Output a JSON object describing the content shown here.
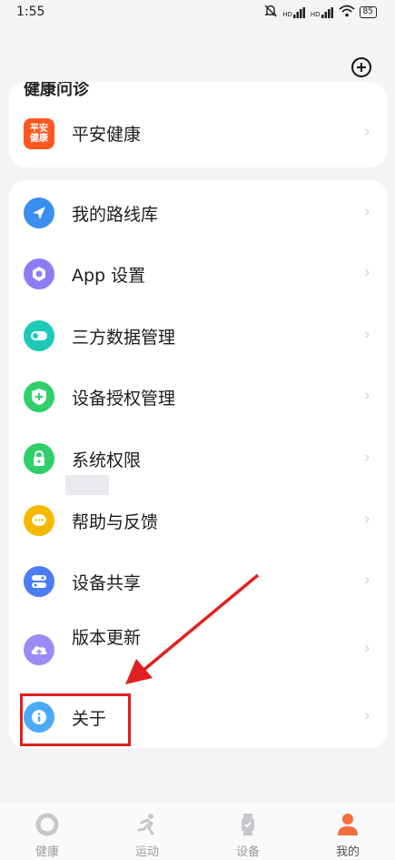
{
  "status": {
    "time": "1:55",
    "signal1": "HD",
    "signal2": "HD",
    "battery": "85"
  },
  "health_section": {
    "partial_title": "健康问诊",
    "items": [
      {
        "label": "平安健康",
        "icon": "ping-an-logo",
        "logo_text": "平安健康"
      }
    ]
  },
  "settings": {
    "items": [
      {
        "label": "我的路线库",
        "icon": "route-icon",
        "color": "#3a8ef0"
      },
      {
        "label": "App 设置",
        "icon": "settings-icon",
        "color": "#8b7cf5"
      },
      {
        "label": "三方数据管理",
        "icon": "toggle-icon",
        "color": "#1ec9b6"
      },
      {
        "label": "设备授权管理",
        "icon": "shield-icon",
        "color": "#2fcf6b"
      },
      {
        "label": "系统权限",
        "icon": "lock-icon",
        "color": "#2fcf6b"
      },
      {
        "label": "帮助与反馈",
        "icon": "chat-icon",
        "color": "#f5b800"
      },
      {
        "label": "设备共享",
        "icon": "share-toggle-icon",
        "color": "#4b7cf2"
      },
      {
        "label": "版本更新",
        "icon": "cloud-upload-icon",
        "color": "#9b8cf5"
      },
      {
        "label": "关于",
        "icon": "info-icon",
        "color": "#4aaaf5"
      }
    ]
  },
  "tabs": [
    {
      "label": "健康",
      "icon": "health-ring-icon"
    },
    {
      "label": "运动",
      "icon": "running-icon"
    },
    {
      "label": "设备",
      "icon": "watch-icon"
    },
    {
      "label": "我的",
      "icon": "person-icon",
      "active": true,
      "active_color": "#f36c3c"
    }
  ]
}
